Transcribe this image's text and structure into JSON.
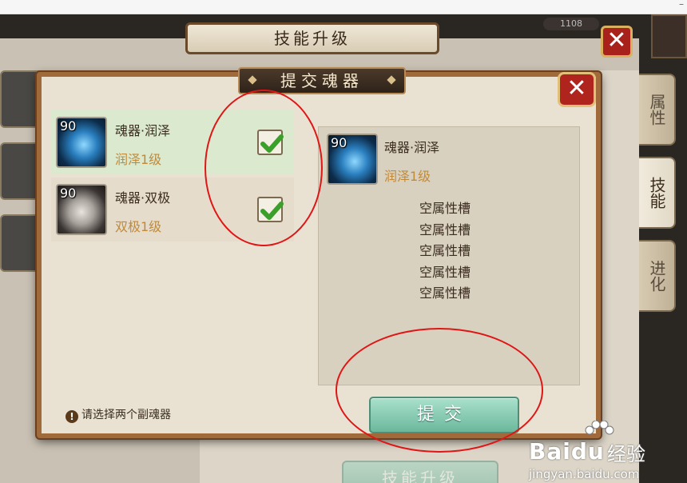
{
  "background_window": {
    "title": "技能升级",
    "close_label": "✕",
    "tabs": [
      "属性",
      "技能",
      "进化"
    ],
    "coins": "1108",
    "upgrade_button": "技能升级"
  },
  "dialog": {
    "title": "提交魂器",
    "close_label": "✕",
    "items": [
      {
        "level": "90",
        "name": "魂器·润泽",
        "sub_level": "润泽1级",
        "checked": true,
        "icon": "blue-orb-icon"
      },
      {
        "level": "90",
        "name": "魂器·双极",
        "sub_level": "双极1级",
        "checked": true,
        "icon": "white-claw-icon"
      }
    ],
    "detail": {
      "level": "90",
      "name": "魂器·润泽",
      "sub_level": "润泽1级",
      "slots": [
        "空属性槽",
        "空属性槽",
        "空属性槽",
        "空属性槽",
        "空属性槽"
      ]
    },
    "hint": "请选择两个副魂器",
    "submit_label": "提交"
  },
  "colors": {
    "accent_green": "#6bb89c",
    "close_red": "#b0241e",
    "frame_brown": "#a06a3b",
    "annotation_red": "#e01515",
    "level_text": "#c08a3a"
  },
  "watermark": {
    "logo": "Baidu",
    "suffix": "经验",
    "url": "jingyan.baidu.com"
  }
}
